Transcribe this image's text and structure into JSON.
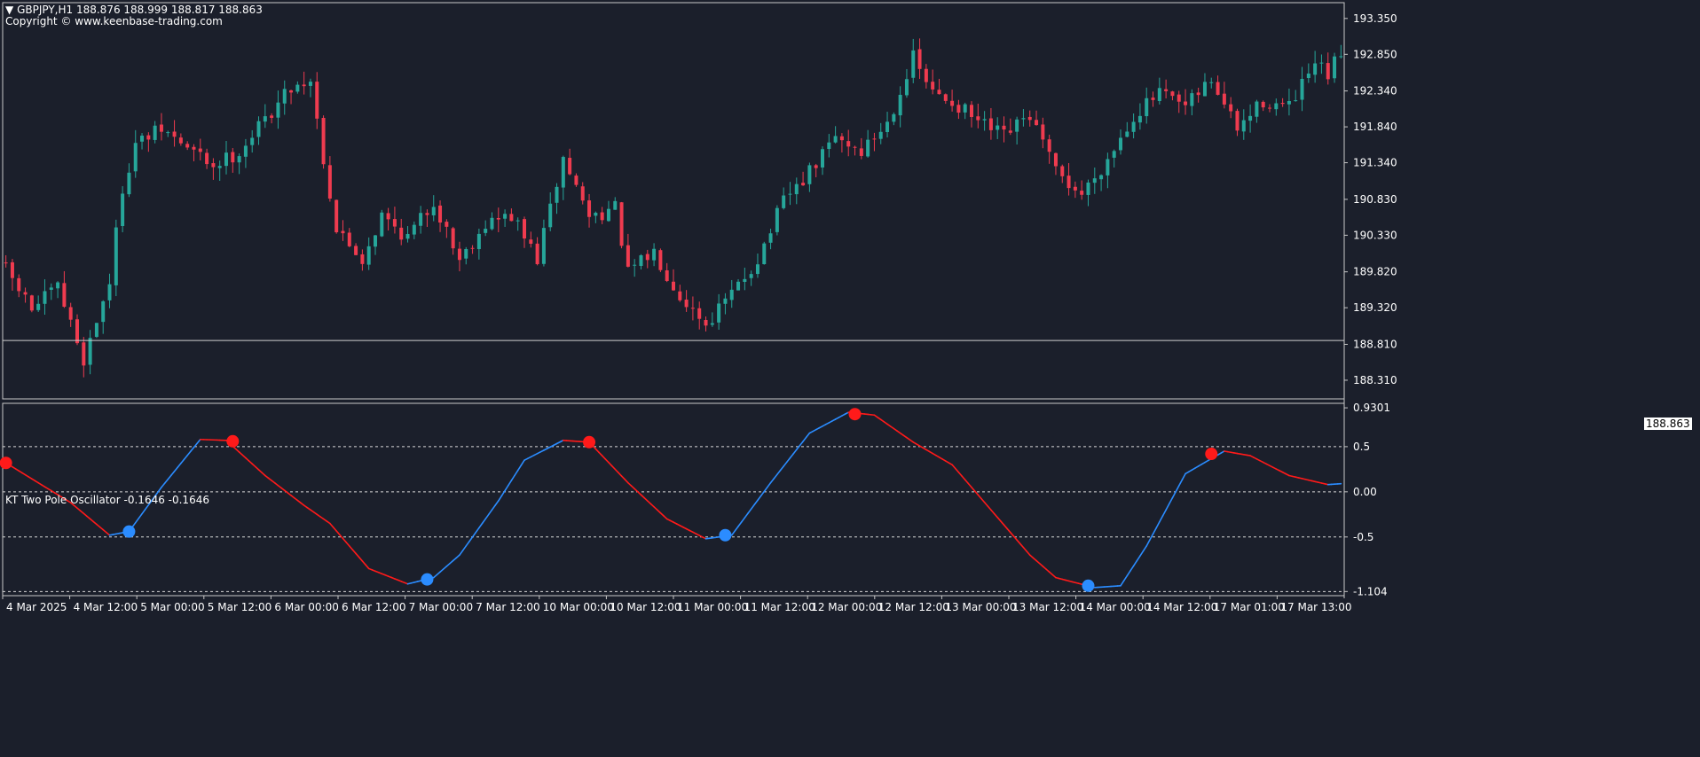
{
  "main": {
    "symbol_line": "GBPJPY,H1  188.876 188.999 188.817 188.863",
    "copyright": "Copyright © www.keenbase-trading.com",
    "current_price": "188.863",
    "y_ticks": [
      "193.350",
      "192.850",
      "192.340",
      "191.840",
      "191.340",
      "190.830",
      "190.330",
      "189.820",
      "189.320",
      "188.810",
      "188.310"
    ],
    "y_min": 188.05,
    "y_max": 193.57,
    "colors": {
      "bull": "#26a69a",
      "bear": "#ef3b4f",
      "bg": "#1b1f2b",
      "grid": "#2c3140",
      "axis_text": "#ffffff"
    }
  },
  "oscillator": {
    "label": "KT Two Pole Oscillator -0.1646 -0.1646",
    "y_ticks": [
      "0.9301",
      "0.5",
      "0.00",
      "-0.5",
      "-1.104"
    ],
    "levels": [
      0.5,
      0.0,
      -0.5
    ],
    "y_min": -1.15,
    "y_max": 0.98,
    "colors": {
      "up": "#2b8cff",
      "down": "#ff1a1a"
    }
  },
  "x_axis": {
    "labels": [
      "4 Mar 2025",
      "4 Mar 12:00",
      "5 Mar 00:00",
      "5 Mar 12:00",
      "6 Mar 00:00",
      "6 Mar 12:00",
      "7 Mar 00:00",
      "7 Mar 12:00",
      "10 Mar 00:00",
      "10 Mar 12:00",
      "11 Mar 00:00",
      "11 Mar 12:00",
      "12 Mar 00:00",
      "12 Mar 12:00",
      "13 Mar 00:00",
      "13 Mar 12:00",
      "14 Mar 00:00",
      "14 Mar 12:00",
      "17 Mar 01:00",
      "17 Mar 13:00"
    ]
  },
  "chart_data": [
    {
      "type": "candlestick",
      "title": "GBPJPY,H1",
      "ylim": [
        188.05,
        193.57
      ],
      "x_tick_labels": [
        "4 Mar 2025",
        "4 Mar 12:00",
        "5 Mar 00:00",
        "5 Mar 12:00",
        "6 Mar 00:00",
        "6 Mar 12:00",
        "7 Mar 00:00",
        "7 Mar 12:00",
        "10 Mar 00:00",
        "10 Mar 12:00",
        "11 Mar 00:00",
        "11 Mar 12:00",
        "12 Mar 00:00",
        "12 Mar 12:00",
        "13 Mar 00:00",
        "13 Mar 12:00",
        "14 Mar 00:00",
        "14 Mar 12:00",
        "17 Mar 01:00",
        "17 Mar 13:00"
      ],
      "close_path": [
        [
          0,
          189.85
        ],
        [
          4,
          189.3
        ],
        [
          8,
          189.6
        ],
        [
          12,
          188.6
        ],
        [
          16,
          189.7
        ],
        [
          18,
          191.0
        ],
        [
          20,
          191.6
        ],
        [
          24,
          191.8
        ],
        [
          28,
          191.55
        ],
        [
          32,
          191.3
        ],
        [
          36,
          191.5
        ],
        [
          40,
          191.95
        ],
        [
          44,
          192.4
        ],
        [
          47,
          192.5
        ],
        [
          49,
          191.4
        ],
        [
          51,
          190.4
        ],
        [
          55,
          190.0
        ],
        [
          58,
          190.6
        ],
        [
          62,
          190.3
        ],
        [
          66,
          190.8
        ],
        [
          70,
          190.0
        ],
        [
          74,
          190.5
        ],
        [
          78,
          190.6
        ],
        [
          82,
          190.0
        ],
        [
          86,
          191.4
        ],
        [
          90,
          190.6
        ],
        [
          94,
          190.7
        ],
        [
          96,
          189.8
        ],
        [
          100,
          190.1
        ],
        [
          104,
          189.5
        ],
        [
          108,
          189.1
        ],
        [
          112,
          189.5
        ],
        [
          116,
          190.0
        ],
        [
          120,
          190.8
        ],
        [
          124,
          191.2
        ],
        [
          128,
          191.7
        ],
        [
          132,
          191.5
        ],
        [
          136,
          191.9
        ],
        [
          140,
          192.8
        ],
        [
          143,
          192.3
        ],
        [
          146,
          192.2
        ],
        [
          150,
          191.9
        ],
        [
          154,
          191.7
        ],
        [
          158,
          192.0
        ],
        [
          162,
          191.2
        ],
        [
          166,
          190.9
        ],
        [
          170,
          191.4
        ],
        [
          174,
          192.0
        ],
        [
          178,
          192.3
        ],
        [
          182,
          192.1
        ],
        [
          186,
          192.5
        ],
        [
          190,
          191.8
        ],
        [
          194,
          192.2
        ],
        [
          198,
          192.1
        ],
        [
          202,
          192.7
        ],
        [
          204,
          192.55
        ],
        [
          206,
          192.88
        ]
      ]
    },
    {
      "type": "line",
      "title": "KT Two Pole Oscillator -0.1646 -0.1646",
      "ylim": [
        -1.15,
        0.98
      ],
      "x_tick_labels": [
        "4 Mar 2025",
        "4 Mar 12:00",
        "5 Mar 00:00",
        "5 Mar 12:00",
        "6 Mar 00:00",
        "6 Mar 12:00",
        "7 Mar 00:00",
        "7 Mar 12:00",
        "10 Mar 00:00",
        "10 Mar 12:00",
        "11 Mar 00:00",
        "11 Mar 12:00",
        "12 Mar 00:00",
        "12 Mar 12:00",
        "13 Mar 00:00",
        "13 Mar 12:00",
        "14 Mar 00:00",
        "14 Mar 12:00",
        "17 Mar 01:00",
        "17 Mar 13:00"
      ],
      "series": [
        {
          "points": [
            [
              0,
              0.32
            ],
            [
              5,
              0.1
            ],
            [
              10,
              -0.12
            ],
            [
              16,
              -0.48
            ],
            [
              19,
              -0.44
            ],
            [
              24,
              0.05
            ],
            [
              30,
              0.58
            ],
            [
              34,
              0.57
            ],
            [
              40,
              0.18
            ],
            [
              46,
              -0.15
            ],
            [
              50,
              -0.35
            ],
            [
              56,
              -0.85
            ],
            [
              62,
              -1.02
            ],
            [
              66,
              -0.95
            ],
            [
              70,
              -0.7
            ],
            [
              76,
              -0.1
            ],
            [
              80,
              0.35
            ],
            [
              86,
              0.57
            ],
            [
              90,
              0.55
            ],
            [
              96,
              0.1
            ],
            [
              102,
              -0.3
            ],
            [
              108,
              -0.52
            ],
            [
              112,
              -0.48
            ],
            [
              118,
              0.1
            ],
            [
              124,
              0.65
            ],
            [
              130,
              0.88
            ],
            [
              134,
              0.85
            ],
            [
              140,
              0.55
            ],
            [
              146,
              0.3
            ],
            [
              152,
              -0.2
            ],
            [
              158,
              -0.7
            ],
            [
              162,
              -0.95
            ],
            [
              168,
              -1.06
            ],
            [
              172,
              -1.04
            ],
            [
              176,
              -0.6
            ],
            [
              182,
              0.2
            ],
            [
              188,
              0.45
            ],
            [
              192,
              0.4
            ],
            [
              198,
              0.18
            ],
            [
              204,
              0.08
            ],
            [
              206,
              0.09
            ]
          ]
        }
      ],
      "signals": [
        {
          "type": "sell",
          "x": 0,
          "y": 0.32
        },
        {
          "type": "buy",
          "x": 19,
          "y": -0.44
        },
        {
          "type": "sell",
          "x": 35,
          "y": 0.56
        },
        {
          "type": "buy",
          "x": 65,
          "y": -0.97
        },
        {
          "type": "sell",
          "x": 90,
          "y": 0.55
        },
        {
          "type": "buy",
          "x": 111,
          "y": -0.48
        },
        {
          "type": "sell",
          "x": 131,
          "y": 0.86
        },
        {
          "type": "buy",
          "x": 167,
          "y": -1.04
        },
        {
          "type": "sell",
          "x": 186,
          "y": 0.42
        }
      ]
    }
  ]
}
